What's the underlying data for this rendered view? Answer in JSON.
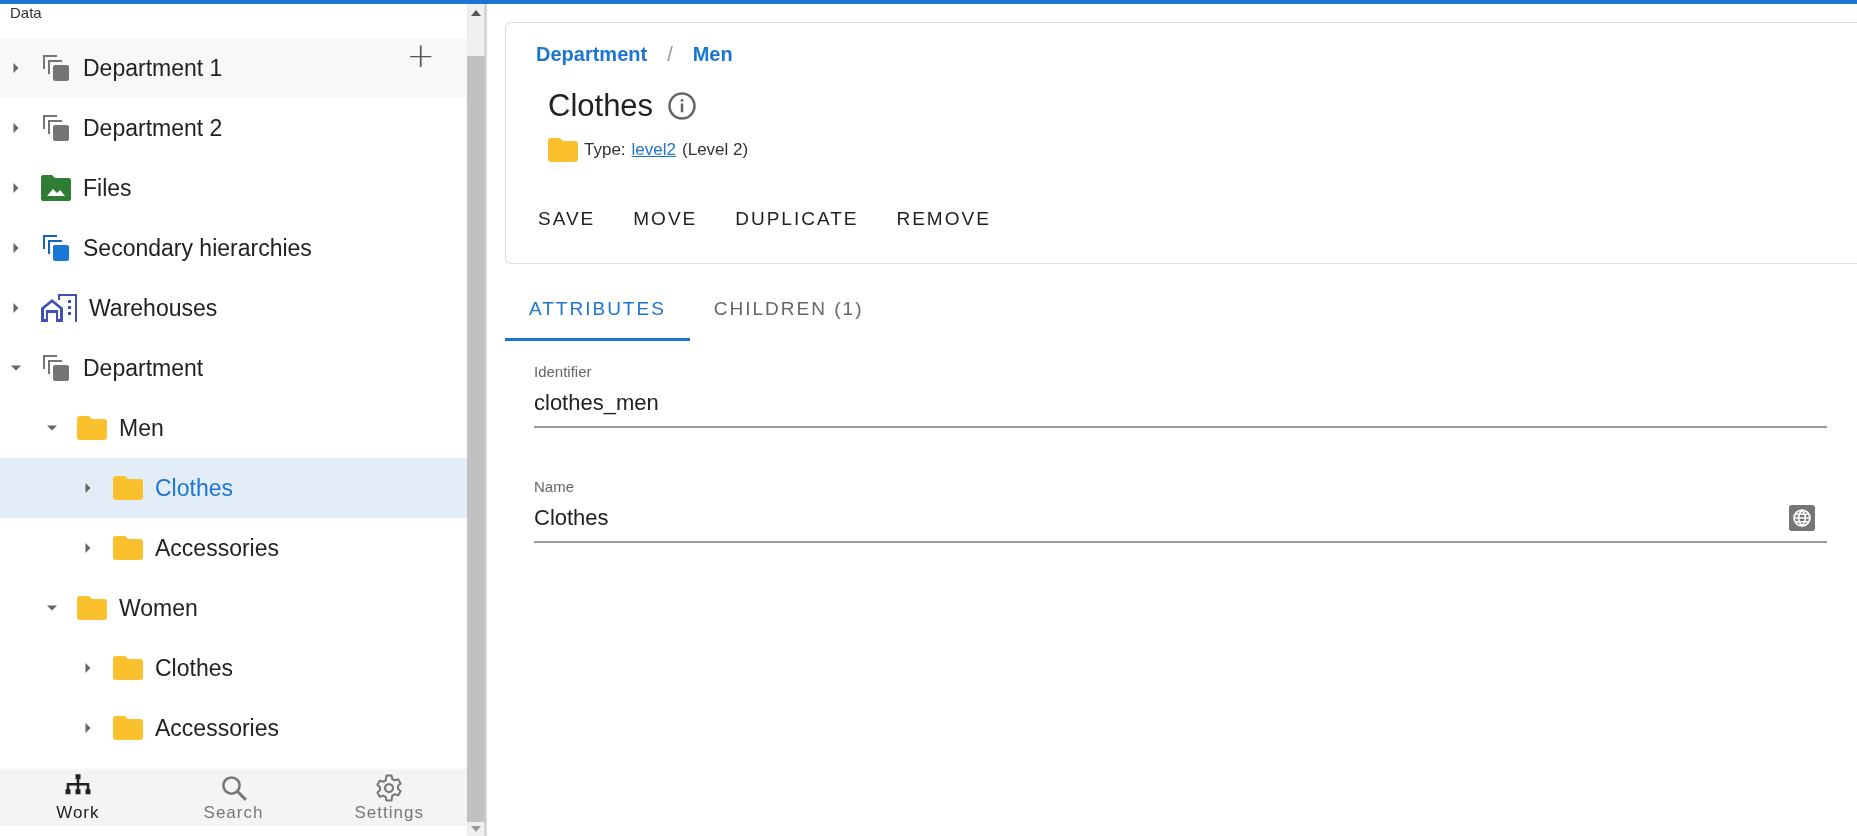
{
  "loading_bar": {
    "level": 1
  },
  "sidebar": {
    "title": "Data",
    "add_button": "+",
    "tree": [
      {
        "label": "Department 1",
        "kind": "stack",
        "expanded": false,
        "selected": false,
        "hovered": true
      },
      {
        "label": "Department 2",
        "kind": "stack",
        "expanded": false,
        "selected": false
      },
      {
        "label": "Files",
        "kind": "files",
        "expanded": false,
        "selected": false
      },
      {
        "label": "Secondary hierarchies",
        "kind": "secondary",
        "expanded": false,
        "selected": false
      },
      {
        "label": "Warehouses",
        "kind": "warehouse",
        "expanded": false,
        "selected": false
      },
      {
        "label": "Department",
        "kind": "stack",
        "expanded": true,
        "selected": false,
        "children": [
          {
            "label": "Men",
            "kind": "folder",
            "expanded": true,
            "selected": false,
            "children": [
              {
                "label": "Clothes",
                "kind": "folder",
                "expanded": false,
                "selected": true
              },
              {
                "label": "Accessories",
                "kind": "folder",
                "expanded": false,
                "selected": false
              }
            ]
          },
          {
            "label": "Women",
            "kind": "folder",
            "expanded": true,
            "selected": false,
            "children": [
              {
                "label": "Clothes",
                "kind": "folder",
                "expanded": false,
                "selected": false
              },
              {
                "label": "Accessories",
                "kind": "folder",
                "expanded": false,
                "selected": false
              }
            ]
          }
        ]
      }
    ],
    "nav": [
      {
        "label": "Work",
        "kind": "tree",
        "selected": true
      },
      {
        "label": "Search",
        "kind": "search",
        "selected": false
      },
      {
        "label": "Settings",
        "kind": "gear",
        "selected": false
      }
    ]
  },
  "header": {
    "breadcrumb": [
      "Department",
      "/",
      "Men"
    ],
    "title": "Clothes",
    "type_label": "Type:",
    "type_link": "level2",
    "type_name": "(Level 2)",
    "actions": [
      "SAVE",
      "MOVE",
      "DUPLICATE",
      "REMOVE"
    ]
  },
  "tabs": [
    {
      "label": "ATTRIBUTES",
      "selected": true
    },
    {
      "label": "CHILDREN (1)",
      "selected": false
    }
  ],
  "fields": [
    {
      "label": "Identifier",
      "value": "clothes_men",
      "translatable": false
    },
    {
      "label": "Name",
      "value": "Clothes",
      "translatable": true
    }
  ]
}
